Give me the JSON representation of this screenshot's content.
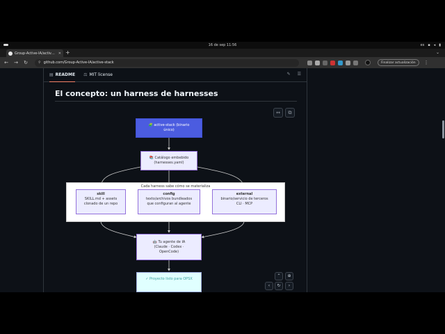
{
  "os": {
    "clock": "16 de sep 11:56",
    "lang": "es"
  },
  "browser": {
    "tab_title": "Group-Active-IA/active-st...",
    "new_tab": "+",
    "url": "github.com/Group-Active-IA/active-stack",
    "update_label": "Finalizar actualización",
    "menu": "⋮"
  },
  "readme": {
    "tab_readme": "README",
    "tab_license": "MIT license",
    "heading": "El concepto: un harness de harnesses"
  },
  "diagram": {
    "node_stack_line1": "🧩 active-stack (binario",
    "node_stack_line2": "único)",
    "node_catalog_line1": "📚 Catálogo embebido",
    "node_catalog_line2": "(harnesses.yaml)",
    "cluster_title": "Cada harness sabe cómo se materializa",
    "skill_title": "skill",
    "skill_line1": "SKILL.md + assets",
    "skill_line2": "clonado de un repo",
    "config_title": "config",
    "config_line1": "texto/archivos bundleados",
    "config_line2": "que configuran al agente",
    "external_title": "external",
    "external_line1": "binario/servicio de terceros",
    "external_line2": "CLI · MCP",
    "agent_line1": "🤖 Tu agente de IA",
    "agent_line2": "(Claude · Codex ·",
    "agent_line3": "OpenCode)",
    "done_line1": "✓ Proyecto listo para OPSX"
  },
  "colors": {
    "page_bg": "#0d1117",
    "stack_node": "#4b5ce0",
    "node_fill": "#ececff",
    "node_border": "#9370db"
  }
}
